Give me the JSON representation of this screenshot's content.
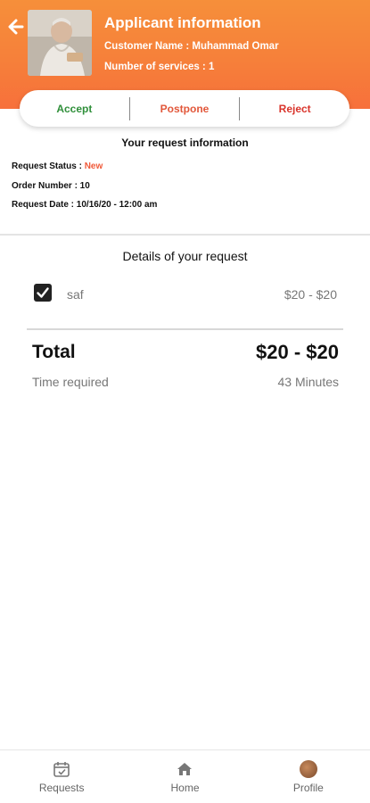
{
  "header": {
    "title": "Applicant information",
    "customer_line": "Customer Name : Muhammad Omar",
    "services_line": "Number of services  : 1",
    "back_icon": "arrow-left-icon",
    "background": "#f6803a"
  },
  "actions": {
    "accept": "Accept",
    "postpone": "Postpone",
    "reject": "Reject",
    "colors": {
      "accept": "#2f8f3a",
      "postpone": "#e2573a",
      "reject": "#d9342b"
    }
  },
  "request_info": {
    "title": "Your request information",
    "status_label": "Request Status : ",
    "status_value": "New",
    "order_line": "Order Number : 10",
    "date_line": "Request Date : 10/16/20 - 12:00 am"
  },
  "details": {
    "title": "Details of your request",
    "items": [
      {
        "name": "saf",
        "price": "$20 - $20",
        "checked": true
      }
    ],
    "total_label": "Total",
    "total_value": "$20 - $20",
    "time_label": "Time required",
    "time_value": "43 Minutes"
  },
  "nav": {
    "items": [
      {
        "label": "Requests",
        "icon": "calendar-check-icon"
      },
      {
        "label": "Home",
        "icon": "home-icon"
      },
      {
        "label": "Profile",
        "icon": "profile-avatar"
      }
    ]
  }
}
